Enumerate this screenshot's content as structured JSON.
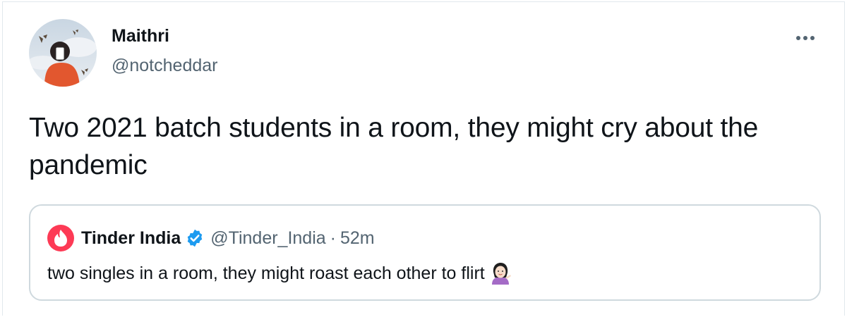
{
  "tweet": {
    "author": {
      "name": "Maithri",
      "handle": "@notcheddar",
      "avatar_icon": "profile-photo"
    },
    "more_icon": "more-options-icon",
    "text": "Two 2021 batch students in a room, they might cry about the pandemic"
  },
  "quote": {
    "name": "Tinder India",
    "verified_icon": "verified-badge-icon",
    "handle": "@Tinder_India",
    "separator": "·",
    "time": "52m",
    "text": "two singles in a room, they might roast each other to flirt",
    "emoji": "woman-tipping-hand-emoji"
  },
  "colors": {
    "text_primary": "#0f1419",
    "text_secondary": "#536471",
    "border": "#cfd9de",
    "verified_blue": "#1d9bf0",
    "tinder_red": "#fd3a55"
  }
}
